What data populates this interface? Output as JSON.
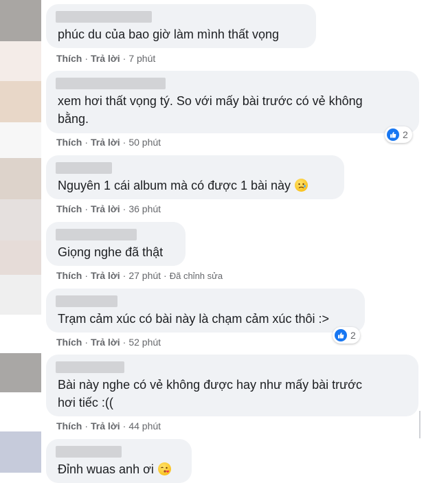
{
  "colors": {
    "like_blue": "#1877f2",
    "meta_gray": "#65676b",
    "bubble_bg": "#f0f2f5"
  },
  "action_labels": {
    "like": "Thích",
    "reply": "Trả lời",
    "separator": "·"
  },
  "comments": [
    {
      "text_lines": [
        "phúc du của bao giờ làm mình thất vọng"
      ],
      "time": "7 phút",
      "edited": "",
      "reactions": ""
    },
    {
      "text_lines": [
        "xem hơi thất vọng tý. So với mấy bài trước có vẻ không",
        "bằng."
      ],
      "time": "50 phút",
      "edited": "",
      "reactions": "2",
      "reaction_icon": "like-icon"
    },
    {
      "text_lines": [
        "Nguyên 1 cái album mà có được 1 bài này"
      ],
      "emoji": "sad-smile-emoji",
      "time": "36 phút",
      "edited": "",
      "reactions": ""
    },
    {
      "text_lines": [
        "Giọng nghe đã thật"
      ],
      "time": "27 phút",
      "edited": "Đã chỉnh sửa",
      "reactions": ""
    },
    {
      "text_lines": [
        "Trạm cảm xúc có bài này là chạm cảm xúc thôi :>"
      ],
      "time": "52 phút",
      "edited": "",
      "reactions": "2",
      "reaction_icon": "like-icon"
    },
    {
      "text_lines": [
        "Bài này nghe có vẻ không được hay như mấy bài trước",
        "hơi tiếc :(("
      ],
      "time": "44 phút",
      "edited": "",
      "reactions": ""
    },
    {
      "text_lines": [
        "Đỉnh wuas anh ơi"
      ],
      "emoji": "kiss-emoji",
      "time": "",
      "edited": "",
      "reactions": ""
    }
  ]
}
